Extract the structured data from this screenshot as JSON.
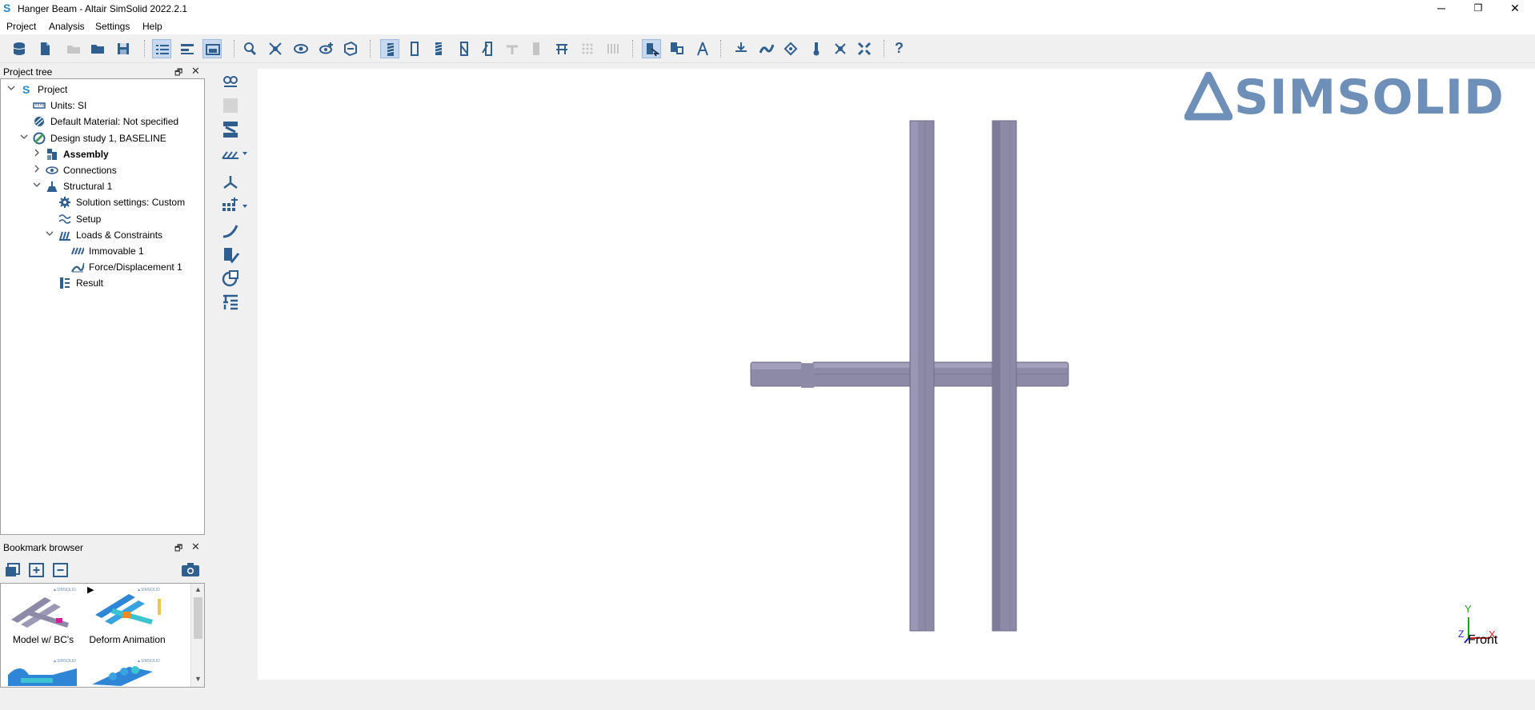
{
  "window": {
    "title": "Hanger Beam - Altair SimSolid 2022.2.1",
    "app_icon": "S",
    "minimize_glyph": "─",
    "restore_glyph": "❐",
    "close_glyph": "✕"
  },
  "menu": {
    "items": [
      "Project",
      "Analysis",
      "Settings",
      "Help"
    ]
  },
  "toolbar": {
    "groups": [
      "file",
      "panels",
      "view",
      "display",
      "analysis",
      "help"
    ],
    "help_glyph": "?"
  },
  "project_tree": {
    "title": "Project tree",
    "float_glyph": "🗗",
    "close_glyph": "✕",
    "nodes": [
      {
        "label": "Project",
        "icon": "simsolid-logo-icon",
        "level": 0,
        "toggle": "expanded"
      },
      {
        "label": "Units: SI",
        "icon": "ruler-icon",
        "level": 1,
        "toggle": "none"
      },
      {
        "label": "Default Material: Not specified",
        "icon": "material-icon",
        "level": 1,
        "toggle": "none"
      },
      {
        "label": "Design study 1, BASELINE",
        "icon": "design-study-icon",
        "level": 1,
        "toggle": "expanded"
      },
      {
        "label": "Assembly",
        "icon": "assembly-icon",
        "level": 2,
        "toggle": "collapsed",
        "bold": true
      },
      {
        "label": "Connections",
        "icon": "connections-icon",
        "level": 2,
        "toggle": "collapsed"
      },
      {
        "label": "Structural  1",
        "icon": "structural-icon",
        "level": 2,
        "toggle": "expanded"
      },
      {
        "label": "Solution settings: Custom",
        "icon": "gear-icon",
        "level": 3,
        "toggle": "none"
      },
      {
        "label": "Setup",
        "icon": "setup-icon",
        "level": 3,
        "toggle": "none"
      },
      {
        "label": "Loads & Constraints",
        "icon": "loads-icon",
        "level": 3,
        "toggle": "expanded"
      },
      {
        "label": "Immovable 1",
        "icon": "immovable-icon",
        "level": 4,
        "toggle": "none"
      },
      {
        "label": "Force/Displacement 1",
        "icon": "force-icon",
        "level": 4,
        "toggle": "none"
      },
      {
        "label": "Result",
        "icon": "result-icon",
        "level": 3,
        "toggle": "none"
      }
    ]
  },
  "bookmark_browser": {
    "title": "Bookmark browser",
    "float_glyph": "🗗",
    "close_glyph": "✕",
    "play_glyph": "▶",
    "scroll_up_glyph": "▲",
    "scroll_down_glyph": "▼",
    "thumbnails": [
      {
        "label": "Model w/ BC's"
      },
      {
        "label": "Deform Animation"
      },
      {
        "label": ""
      },
      {
        "label": ""
      }
    ]
  },
  "viewport": {
    "brand": "SIMSOLID",
    "triad": {
      "y": "Y",
      "x": "X",
      "z": "Z",
      "view": "Front"
    }
  },
  "colors": {
    "beam": "#8d8aa8",
    "beam_dark": "#7a7794",
    "beam_light": "#a19fba",
    "brand": "#6e8fb8",
    "accent": "#2a87c9"
  }
}
